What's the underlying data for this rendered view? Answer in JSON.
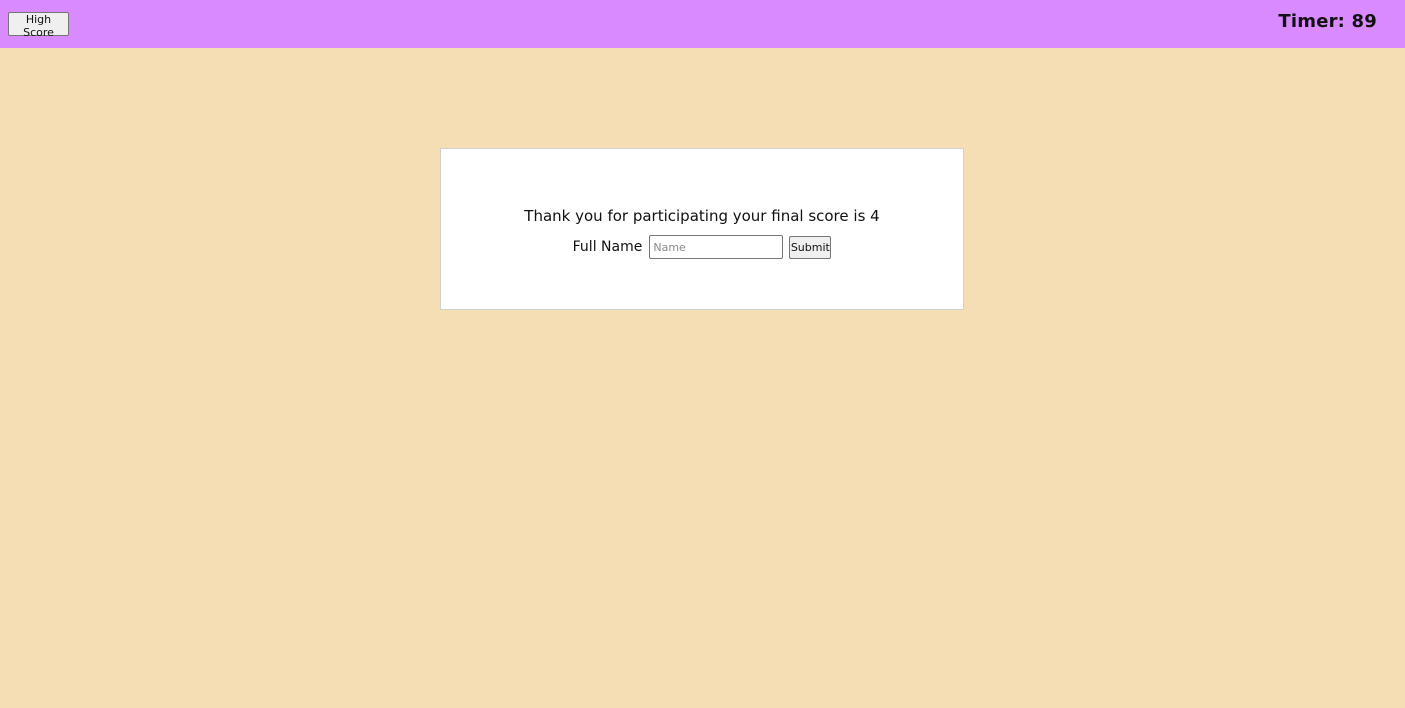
{
  "header": {
    "high_score_label": "High Score",
    "timer_text": "Timer: 89"
  },
  "result": {
    "message": "Thank you for participating your final score is 4",
    "name_label": "Full Name",
    "name_placeholder": "Name",
    "name_value": "",
    "submit_label": "Submit"
  },
  "colors": {
    "header_bg": "#d98aff",
    "page_bg": "#f5deb3",
    "card_bg": "#ffffff"
  }
}
